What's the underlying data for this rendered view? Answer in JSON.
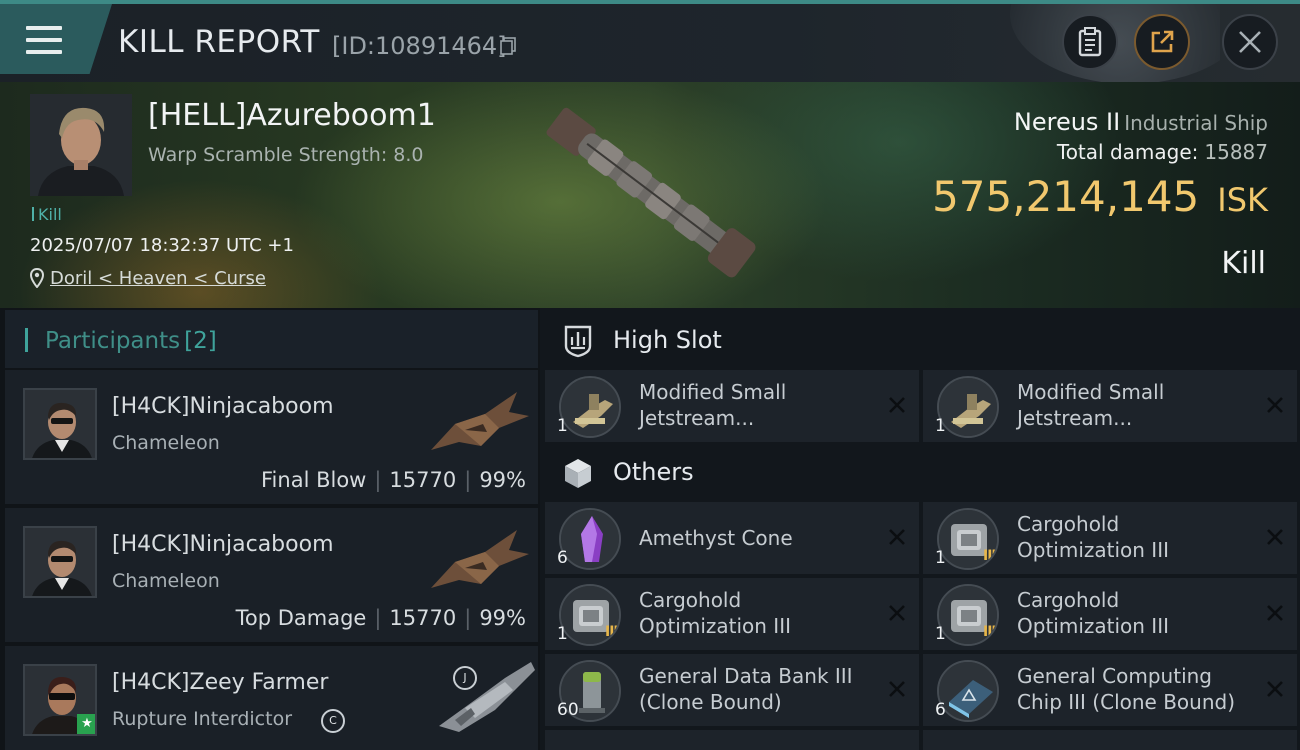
{
  "header": {
    "title": "KILL REPORT",
    "kill_id": "[ID:10891464]",
    "icons": [
      "menu-icon",
      "copy-icon",
      "clipboard-icon",
      "share-icon",
      "close-icon"
    ]
  },
  "victim": {
    "name": "[HELL]Azureboom1",
    "warp_scramble": "Warp Scramble Strength: 8.0",
    "tag": "Kill",
    "datetime": "2025/07/07 18:32:37 UTC +1",
    "location": "Doril < Heaven < Curse",
    "ship_name": "Nereus II",
    "ship_class": "Industrial Ship",
    "total_damage_label": "Total damage:",
    "total_damage_value": "15887",
    "isk_value": "575,214,145",
    "isk_unit": "ISK",
    "result": "Kill"
  },
  "participants": {
    "title": "Participants",
    "count": "[2]",
    "rows": [
      {
        "name": "[H4CK]Ninjacaboom",
        "ship": "Chameleon",
        "role": "Final Blow",
        "damage": "15770",
        "percent": "99%"
      },
      {
        "name": "[H4CK]Ninjacaboom",
        "ship": "Chameleon",
        "role": "Top Damage",
        "damage": "15770",
        "percent": "99%"
      },
      {
        "name": "[H4CK]Zeey Farmer",
        "ship": "Rupture Interdictor",
        "badge": "C",
        "ship_badge": "J"
      }
    ]
  },
  "fitting": {
    "high_slot": {
      "title": "High Slot",
      "items": [
        {
          "qty": "1",
          "name": "Modified Small Jetstream..."
        },
        {
          "qty": "1",
          "name": "Modified Small Jetstream..."
        }
      ]
    },
    "others": {
      "title": "Others",
      "items": [
        {
          "qty": "6",
          "name": "Amethyst Cone"
        },
        {
          "qty": "1",
          "name": "Cargohold Optimization III",
          "tier": "III"
        },
        {
          "qty": "1",
          "name": "Cargohold Optimization III",
          "tier": "III"
        },
        {
          "qty": "1",
          "name": "Cargohold Optimization III",
          "tier": "III"
        },
        {
          "qty": "60",
          "name": "General Data Bank III (Clone Bound)"
        },
        {
          "qty": "6",
          "name": "General Computing Chip III (Clone Bound)"
        }
      ]
    }
  },
  "colors": {
    "accent_teal": "#3fa39b",
    "isk_gold": "#f1c86e",
    "panel": "#1d232a"
  }
}
